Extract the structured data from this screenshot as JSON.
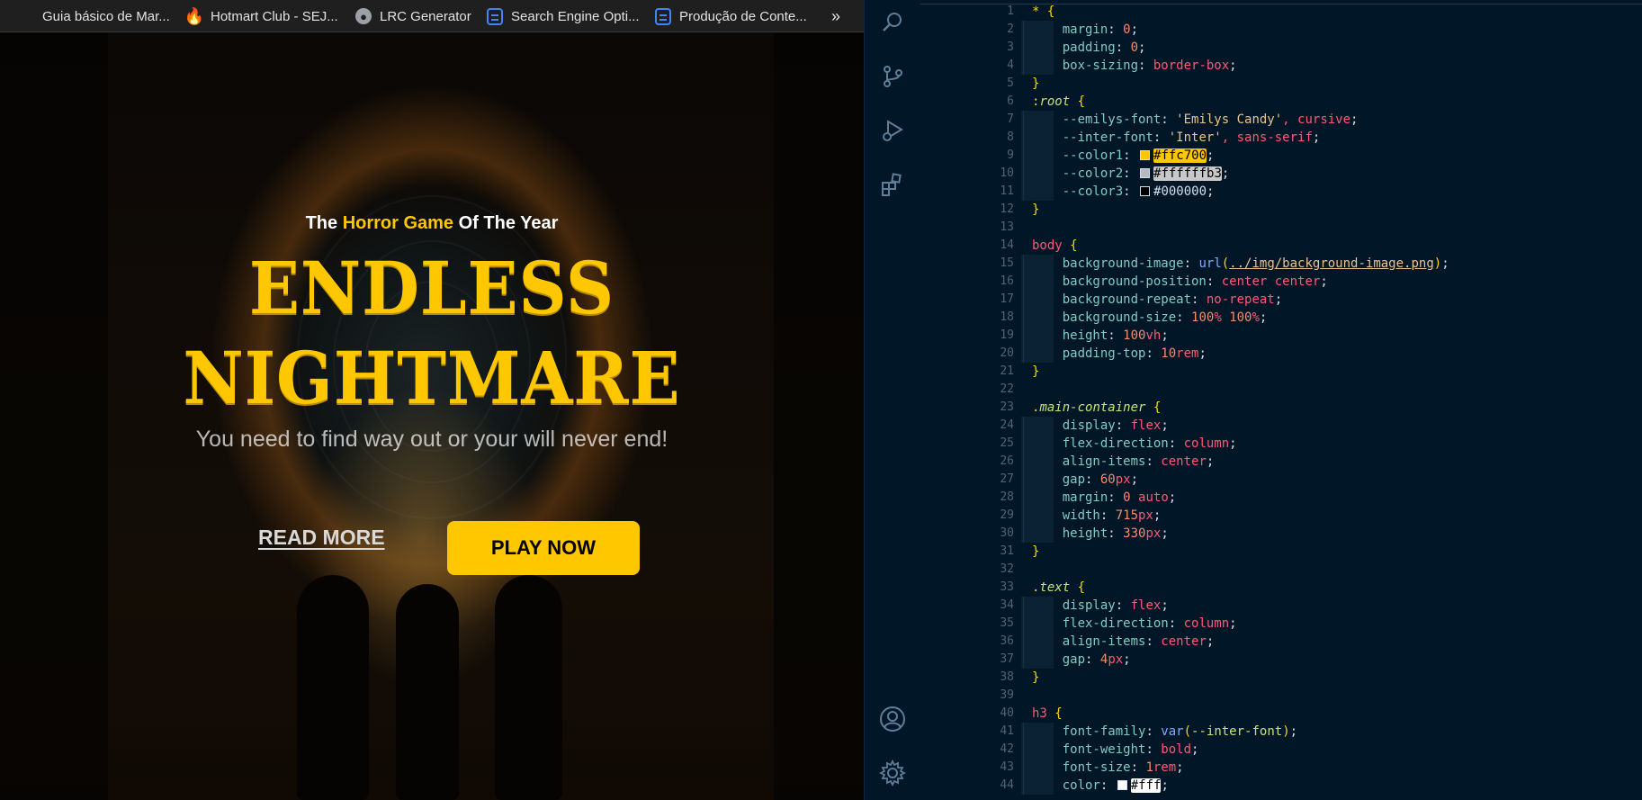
{
  "bookmarks": [
    {
      "label": "Guia básico de Mar...",
      "icon": "none"
    },
    {
      "label": "Hotmart Club - SEJ...",
      "icon": "fire-icon"
    },
    {
      "label": "LRC Generator",
      "icon": "globe-icon"
    },
    {
      "label": "Search Engine Opti...",
      "icon": "doc-icon"
    },
    {
      "label": "Produção de Conte...",
      "icon": "doc-icon"
    }
  ],
  "bookmarks_more": "»",
  "hero": {
    "subtitle_pre": "The ",
    "subtitle_highlight": "Horror Game",
    "subtitle_post": " Of The Year",
    "title_line1": "ENDLESS",
    "title_line2": "NIGHTMARE",
    "tagline": "You need to find way out or your will never end!",
    "read_more": "READ MORE",
    "play_now": "PLAY NOW"
  },
  "colors": {
    "accent": "#ffc700",
    "text_muted": "#ffffffb3",
    "editor_bg": "#011627"
  },
  "editor": {
    "activity_icons": [
      "search-icon",
      "source-control-icon",
      "run-debug-icon",
      "extensions-icon",
      "account-icon",
      "settings-gear-icon"
    ],
    "line_numbers": [
      "1",
      "2",
      "3",
      "4",
      "5",
      "6",
      "7",
      "8",
      "9",
      "10",
      "11",
      "12",
      "13",
      "14",
      "15",
      "16",
      "17",
      "18",
      "19",
      "20",
      "21",
      "22",
      "23",
      "24",
      "25",
      "26",
      "27",
      "28",
      "29",
      "30",
      "31",
      "32",
      "33",
      "34",
      "35",
      "36",
      "37",
      "38",
      "39",
      "40",
      "41",
      "42",
      "43",
      "44"
    ],
    "code_lines": [
      "* {",
      "    margin: 0;",
      "    padding: 0;",
      "    box-sizing: border-box;",
      "}",
      ":root {",
      "    --emilys-font: 'Emilys Candy', cursive;",
      "    --inter-font: 'Inter', sans-serif;",
      "    --color1: #ffc700;",
      "    --color2: #ffffffb3;",
      "    --color3: #000000;",
      "}",
      "",
      "body {",
      "    background-image: url(../img/background-image.png);",
      "    background-position: center center;",
      "    background-repeat: no-repeat;",
      "    background-size: 100% 100%;",
      "    height: 100vh;",
      "    padding-top: 10rem;",
      "}",
      "",
      ".main-container {",
      "    display: flex;",
      "    flex-direction: column;",
      "    align-items: center;",
      "    gap: 60px;",
      "    margin: 0 auto;",
      "    width: 715px;",
      "    height: 330px;",
      "}",
      "",
      ".text {",
      "    display: flex;",
      "    flex-direction: column;",
      "    align-items: center;",
      "    gap: 4px;",
      "}",
      "",
      "h3 {",
      "    font-family: var(--inter-font);",
      "    font-weight: bold;",
      "    font-size: 1rem;",
      "    color: #fff;"
    ]
  }
}
